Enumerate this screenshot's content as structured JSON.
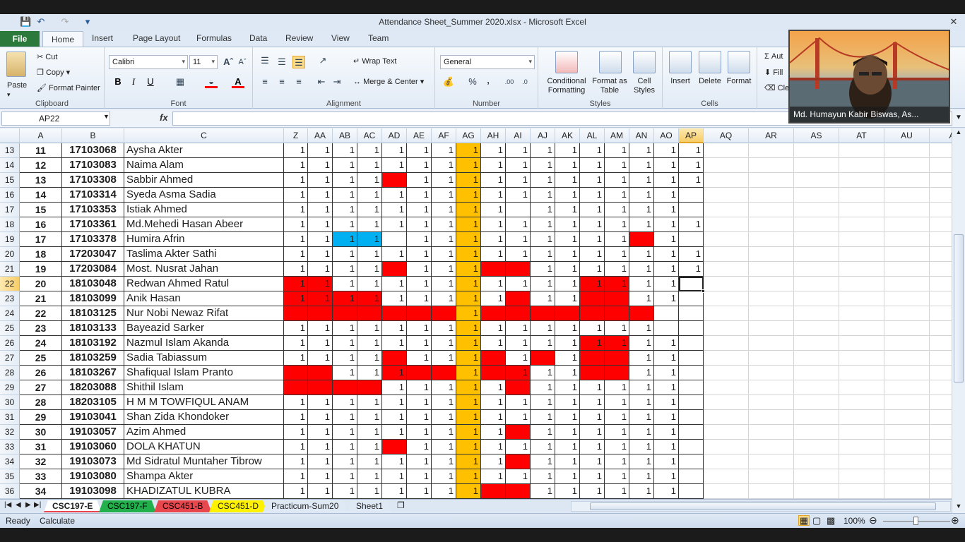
{
  "window": {
    "title": "Attendance Sheet_Summer 2020.xlsx  -  Microsoft Excel"
  },
  "ribbon_tabs": [
    "File",
    "Home",
    "Insert",
    "Page Layout",
    "Formulas",
    "Data",
    "Review",
    "View",
    "Team"
  ],
  "ribbon": {
    "clipboard": {
      "label": "Clipboard",
      "paste": "Paste",
      "cut": "Cut",
      "copy": "Copy",
      "format_painter": "Format Painter"
    },
    "font": {
      "label": "Font",
      "font_name": "Calibri",
      "font_size": "11",
      "bold": "B",
      "italic": "I",
      "underline": "U"
    },
    "alignment": {
      "label": "Alignment",
      "wrap_text": "Wrap Text",
      "merge_center": "Merge & Center"
    },
    "number": {
      "label": "Number",
      "format": "General",
      "percent": "%",
      "comma": ","
    },
    "styles": {
      "label": "Styles",
      "conditional_formatting": "Conditional Formatting",
      "format_as_table": "Format as Table",
      "cell_styles": "Cell Styles"
    },
    "cells": {
      "label": "Cells",
      "insert": "Insert",
      "delete": "Delete",
      "format": "Format"
    },
    "editing": {
      "autosum": "Aut",
      "fill": "Fill",
      "clear": "Cle"
    }
  },
  "formula_bar": {
    "name_box": "AP22",
    "fx": "fx",
    "formula": ""
  },
  "grid": {
    "columns": [
      "A",
      "B",
      "C",
      "Z",
      "AA",
      "AB",
      "AC",
      "AD",
      "AE",
      "AF",
      "AG",
      "AH",
      "AI",
      "AJ",
      "AK",
      "AL",
      "AM",
      "AN",
      "AO",
      "AP",
      "AQ",
      "AR",
      "AS",
      "AT",
      "AU",
      "A"
    ],
    "selected_column": "AP",
    "selected_row": "22",
    "active_cell": "AP22",
    "rows": [
      {
        "row": "13",
        "sl": "11",
        "id": "17103068",
        "name": "Aysha Akter",
        "att": [
          "1",
          "1",
          "1",
          "1",
          "1",
          "1",
          "1",
          "1",
          "1",
          "1",
          "1",
          "1",
          "1",
          "1",
          "1",
          "1",
          "1"
        ]
      },
      {
        "row": "14",
        "sl": "12",
        "id": "17103083",
        "name": "Naima Alam",
        "att": [
          "1",
          "1",
          "1",
          "1",
          "1",
          "1",
          "1",
          "1",
          "1",
          "1",
          "1",
          "1",
          "1",
          "1",
          "1",
          "1",
          "1"
        ]
      },
      {
        "row": "15",
        "sl": "13",
        "id": "17103308",
        "name": "Sabbir Ahmed",
        "att": [
          "1",
          "1",
          "1",
          "1",
          "",
          "1",
          "1",
          "1",
          "1",
          "1",
          "1",
          "1",
          "1",
          "1",
          "1",
          "1",
          "1"
        ]
      },
      {
        "row": "16",
        "sl": "14",
        "id": "17103314",
        "name": "Syeda Asma Sadia",
        "att": [
          "1",
          "1",
          "1",
          "1",
          "1",
          "1",
          "1",
          "1",
          "1",
          "1",
          "1",
          "1",
          "1",
          "1",
          "1",
          "1",
          ""
        ]
      },
      {
        "row": "17",
        "sl": "15",
        "id": "17103353",
        "name": "Istiak Ahmed",
        "att": [
          "1",
          "1",
          "1",
          "1",
          "1",
          "1",
          "1",
          "1",
          "1",
          "",
          "1",
          "1",
          "1",
          "1",
          "1",
          "1",
          ""
        ]
      },
      {
        "row": "18",
        "sl": "16",
        "id": "17103361",
        "name": "Md.Mehedi Hasan Abeer",
        "att": [
          "1",
          "1",
          "1",
          "1",
          "1",
          "1",
          "1",
          "1",
          "1",
          "1",
          "1",
          "1",
          "1",
          "1",
          "1",
          "1",
          "1"
        ]
      },
      {
        "row": "19",
        "sl": "17",
        "id": "17103378",
        "name": "Humira Afrin",
        "att": [
          "1",
          "1",
          "1",
          "1",
          "",
          "1",
          "1",
          "1",
          "1",
          "1",
          "1",
          "1",
          "1",
          "1",
          "",
          "1",
          ""
        ]
      },
      {
        "row": "20",
        "sl": "18",
        "id": "17203047",
        "name": "Taslima Akter Sathi",
        "att": [
          "1",
          "1",
          "1",
          "1",
          "1",
          "1",
          "1",
          "1",
          "1",
          "1",
          "1",
          "1",
          "1",
          "1",
          "1",
          "1",
          "1"
        ]
      },
      {
        "row": "21",
        "sl": "19",
        "id": "17203084",
        "name": "Most. Nusrat Jahan",
        "att": [
          "1",
          "1",
          "1",
          "1",
          "",
          "1",
          "1",
          "1",
          "",
          "",
          "1",
          "1",
          "1",
          "1",
          "1",
          "1",
          "1"
        ]
      },
      {
        "row": "22",
        "sl": "20",
        "id": "18103048",
        "name": "Redwan Ahmed Ratul",
        "att": [
          "1",
          "1",
          "1",
          "1",
          "1",
          "1",
          "1",
          "1",
          "1",
          "1",
          "1",
          "1",
          "1",
          "1",
          "1",
          "1",
          ""
        ]
      },
      {
        "row": "23",
        "sl": "21",
        "id": "18103099",
        "name": "Anik Hasan",
        "att": [
          "1",
          "1",
          "1",
          "1",
          "1",
          "1",
          "1",
          "1",
          "1",
          "",
          "1",
          "1",
          "",
          "",
          "1",
          "1",
          ""
        ]
      },
      {
        "row": "24",
        "sl": "22",
        "id": "18103125",
        "name": "Nur Nobi Newaz Rifat",
        "att": [
          "",
          "",
          "",
          "",
          "",
          "",
          "",
          "1",
          "",
          "",
          "",
          "",
          "",
          "",
          "",
          "",
          ""
        ]
      },
      {
        "row": "25",
        "sl": "23",
        "id": "18103133",
        "name": "Bayeazid Sarker",
        "att": [
          "1",
          "1",
          "1",
          "1",
          "1",
          "1",
          "1",
          "1",
          "1",
          "1",
          "1",
          "1",
          "1",
          "1",
          "1",
          "",
          ""
        ]
      },
      {
        "row": "26",
        "sl": "24",
        "id": "18103192",
        "name": "Nazmul Islam Akanda",
        "att": [
          "1",
          "1",
          "1",
          "1",
          "1",
          "1",
          "1",
          "1",
          "1",
          "1",
          "1",
          "1",
          "1",
          "1",
          "1",
          "1",
          ""
        ]
      },
      {
        "row": "27",
        "sl": "25",
        "id": "18103259",
        "name": "Sadia Tabiassum",
        "att": [
          "1",
          "1",
          "1",
          "1",
          "",
          "1",
          "1",
          "1",
          "",
          "1",
          "",
          "1",
          "",
          "",
          "1",
          "1",
          ""
        ]
      },
      {
        "row": "28",
        "sl": "26",
        "id": "18103267",
        "name": "Shafiqual Islam Pranto",
        "att": [
          "",
          "",
          "1",
          "1",
          "1",
          "",
          "",
          "1",
          "",
          "1",
          "1",
          "1",
          "",
          "",
          "1",
          "1",
          ""
        ]
      },
      {
        "row": "29",
        "sl": "27",
        "id": "18203088",
        "name": "Shithil Islam",
        "att": [
          "",
          "",
          "",
          "",
          "1",
          "1",
          "1",
          "1",
          "1",
          "",
          "1",
          "1",
          "1",
          "1",
          "1",
          "1",
          ""
        ]
      },
      {
        "row": "30",
        "sl": "28",
        "id": "18203105",
        "name": "H M M TOWFIQUL ANAM",
        "att": [
          "1",
          "1",
          "1",
          "1",
          "1",
          "1",
          "1",
          "1",
          "1",
          "1",
          "1",
          "1",
          "1",
          "1",
          "1",
          "1",
          ""
        ]
      },
      {
        "row": "31",
        "sl": "29",
        "id": "19103041",
        "name": "Shan Zida Khondoker",
        "att": [
          "1",
          "1",
          "1",
          "1",
          "1",
          "1",
          "1",
          "1",
          "1",
          "1",
          "1",
          "1",
          "1",
          "1",
          "1",
          "1",
          ""
        ]
      },
      {
        "row": "32",
        "sl": "30",
        "id": "19103057",
        "name": "Azim Ahmed",
        "att": [
          "1",
          "1",
          "1",
          "1",
          "1",
          "1",
          "1",
          "1",
          "1",
          "",
          "1",
          "1",
          "1",
          "1",
          "1",
          "1",
          ""
        ]
      },
      {
        "row": "33",
        "sl": "31",
        "id": "19103060",
        "name": "DOLA KHATUN",
        "att": [
          "1",
          "1",
          "1",
          "1",
          "",
          "1",
          "1",
          "1",
          "1",
          "1",
          "1",
          "1",
          "1",
          "1",
          "1",
          "1",
          ""
        ]
      },
      {
        "row": "34",
        "sl": "32",
        "id": "19103073",
        "name": "Md Sidratul Muntaher Tibrow",
        "att": [
          "1",
          "1",
          "1",
          "1",
          "1",
          "1",
          "1",
          "1",
          "1",
          "",
          "1",
          "1",
          "1",
          "1",
          "1",
          "1",
          ""
        ]
      },
      {
        "row": "35",
        "sl": "33",
        "id": "19103080",
        "name": "Shampa Akter",
        "att": [
          "1",
          "1",
          "1",
          "1",
          "1",
          "1",
          "1",
          "1",
          "1",
          "1",
          "1",
          "1",
          "1",
          "1",
          "1",
          "1",
          ""
        ]
      },
      {
        "row": "36",
        "sl": "34",
        "id": "19103098",
        "name": "KHADIZATUL KUBRA",
        "att": [
          "1",
          "1",
          "1",
          "1",
          "1",
          "1",
          "1",
          "1",
          "",
          "",
          "1",
          "1",
          "1",
          "1",
          "1",
          "1",
          ""
        ]
      }
    ],
    "highlights": {
      "red": [
        "15:AD",
        "19:AN",
        "21:AD",
        "21:AH",
        "21:AI",
        "22:Z",
        "22:AA",
        "22:AL",
        "22:AM",
        "23:Z",
        "23:AA",
        "23:AB",
        "23:AC",
        "23:AI",
        "23:AL",
        "23:AM",
        "24:Z",
        "24:AA",
        "24:AB",
        "24:AC",
        "24:AD",
        "24:AE",
        "24:AF",
        "24:AH",
        "24:AI",
        "24:AJ",
        "24:AK",
        "24:AL",
        "24:AM",
        "24:AN",
        "26:AL",
        "26:AM",
        "27:AD",
        "27:AH",
        "27:AJ",
        "27:AL",
        "27:AM",
        "28:Z",
        "28:AA",
        "28:AD",
        "28:AE",
        "28:AF",
        "28:AH",
        "28:AI",
        "28:AL",
        "28:AM",
        "29:Z",
        "29:AA",
        "29:AB",
        "29:AC",
        "29:AI",
        "32:AI",
        "33:AD",
        "34:AI",
        "36:AH",
        "36:AI"
      ],
      "blue": [
        "19:AB",
        "19:AC"
      ],
      "orange_column": "AG"
    }
  },
  "sheet_tabs": [
    {
      "label": "CSC197-E",
      "active": true,
      "color": "#ffffff"
    },
    {
      "label": "CSC197-F",
      "active": false,
      "color": "#22b04c"
    },
    {
      "label": "CSC451-B",
      "active": false,
      "color": "#e8474d"
    },
    {
      "label": "CSC451-D",
      "active": false,
      "color": "#fff200"
    },
    {
      "label": "Practicum-Sum20",
      "active": false,
      "color": "#dfe9f5"
    },
    {
      "label": "Sheet1",
      "active": false,
      "color": "#dfe9f5"
    }
  ],
  "status": {
    "mode": "Ready",
    "calculate": "Calculate",
    "zoom": "100%"
  },
  "video": {
    "participant": "Md. Humayun Kabir Biswas, As..."
  },
  "colors": {
    "red": "#ff0000",
    "blue": "#00b0f0",
    "orange": "#ffc000",
    "accent": "#2b7a3c"
  }
}
